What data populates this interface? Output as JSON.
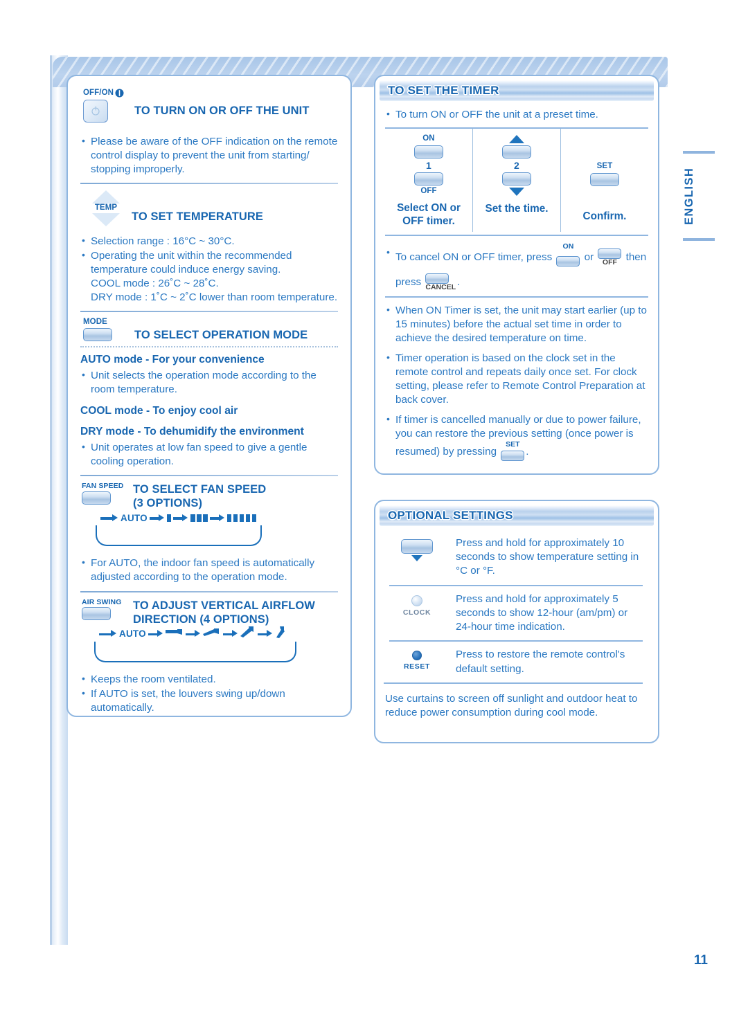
{
  "page": {
    "number": "11",
    "language_tab": "ENGLISH"
  },
  "left_panel": {
    "sections": [
      {
        "id": "turn-on-off",
        "button_label": "OFF/ON",
        "title": "TO TURN ON OR OFF THE UNIT",
        "bullets": [
          "Please be aware of the OFF indication on the remote control display to prevent the unit from starting/ stopping improperly."
        ]
      },
      {
        "id": "set-temperature",
        "button_label": "TEMP",
        "title": "TO SET TEMPERATURE",
        "bullets": [
          "Selection range : 16°C ~ 30°C.",
          "Operating the unit within the recommended temperature could induce energy saving.\nCOOL mode : 26˚C ~ 28˚C.\nDRY mode : 1˚C ~ 2˚C lower than room temperature."
        ]
      },
      {
        "id": "operation-mode",
        "button_label": "MODE",
        "title": "TO SELECT OPERATION MODE",
        "modes": [
          {
            "heading": "AUTO mode - For your convenience",
            "bullets": [
              "Unit selects the operation mode according to the room temperature."
            ]
          },
          {
            "heading": "COOL mode - To enjoy cool air",
            "bullets": []
          },
          {
            "heading": "DRY mode - To dehumidify the environment",
            "bullets": [
              "Unit operates at low fan speed to give a gentle cooling operation."
            ]
          }
        ]
      },
      {
        "id": "fan-speed",
        "button_label": "FAN SPEED",
        "title_line1": "TO SELECT FAN SPEED",
        "title_line2": "(3 OPTIONS)",
        "cycle_start": "AUTO",
        "cycle_steps": [
          1,
          3,
          5
        ],
        "bullets": [
          "For AUTO, the indoor fan speed is automatically adjusted according to the operation mode."
        ]
      },
      {
        "id": "air-swing",
        "button_label": "AIR SWING",
        "title_line1": "TO ADJUST VERTICAL AIRFLOW",
        "title_line2": "DIRECTION  (4 OPTIONS)",
        "cycle_start": "AUTO",
        "cycle_step_count": 4,
        "bullets": [
          "Keeps the room ventilated.",
          "If AUTO is set, the louvers swing up/down automatically."
        ]
      }
    ]
  },
  "timer_panel": {
    "header": "TO SET THE TIMER",
    "intro_bullet": "To turn ON or OFF the unit at a preset time.",
    "steps": [
      {
        "top_label": "ON",
        "number": "1",
        "bottom_label": "OFF",
        "caption": "Select ON or OFF timer."
      },
      {
        "number": "2",
        "caption": "Set the time."
      },
      {
        "top_label": "SET",
        "caption": "Confirm."
      }
    ],
    "cancel_text_parts": {
      "a": "To cancel ON or OFF timer, press",
      "btn1_label": "ON",
      "b": "or",
      "btn2_label": "OFF",
      "c": "then",
      "d": "press",
      "btn3_label": "CANCEL",
      "e": "."
    },
    "bullets": [
      "When ON Timer is set, the unit may start earlier (up to 15 minutes) before the actual set time in order to achieve the desired temperature on time.",
      "Timer operation is based on the clock set in the remote control and repeats daily once set. For clock setting, please refer to Remote Control Preparation at back cover."
    ],
    "restore_bullet": {
      "a": "If timer is cancelled manually or due to power failure, you can restore the previous setting (once power is resumed) by pressing",
      "btn_label": "SET",
      "b": "."
    }
  },
  "optional_panel": {
    "header": "OPTIONAL SETTINGS",
    "rows": [
      {
        "icon": "temp-down-button",
        "icon_label": "",
        "text": "Press and hold for approximately 10 seconds to show temperature setting in °C or °F."
      },
      {
        "icon": "clock-button",
        "icon_label": "CLOCK",
        "text": "Press and hold for approximately 5 seconds to show 12-hour (am/pm) or 24-hour time indication."
      },
      {
        "icon": "reset-button",
        "icon_label": "RESET",
        "text": "Press to restore the remote control's default setting."
      }
    ],
    "footer_note": "Use curtains to screen off sunlight and outdoor heat to reduce power consumption during cool mode."
  },
  "colors": {
    "brand_blue": "#1866b0",
    "body_blue": "#2a78c2",
    "border_blue": "#8fb6e0",
    "icon_blue": "#1a6fba"
  }
}
